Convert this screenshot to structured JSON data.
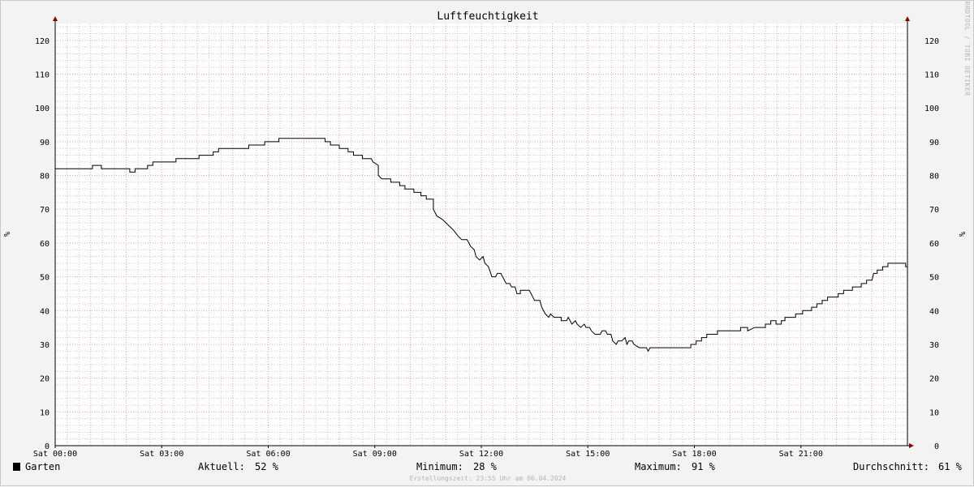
{
  "chart_data": {
    "type": "line",
    "title": "Luftfeuchtigkeit",
    "ylabel": "%",
    "ylim": [
      0,
      125
    ],
    "yticks": [
      0,
      10,
      20,
      30,
      40,
      50,
      60,
      70,
      80,
      90,
      100,
      110,
      120
    ],
    "xlim": [
      0,
      24
    ],
    "xticks": [
      {
        "hour": 0,
        "label": "Sat 00:00"
      },
      {
        "hour": 3,
        "label": "Sat 03:00"
      },
      {
        "hour": 6,
        "label": "Sat 06:00"
      },
      {
        "hour": 9,
        "label": "Sat 09:00"
      },
      {
        "hour": 12,
        "label": "Sat 12:00"
      },
      {
        "hour": 15,
        "label": "Sat 15:00"
      },
      {
        "hour": 18,
        "label": "Sat 18:00"
      },
      {
        "hour": 21,
        "label": "Sat 21:00"
      }
    ],
    "grid": true,
    "series": [
      {
        "name": "Garten",
        "color": "#000000",
        "points": [
          [
            0.0,
            82
          ],
          [
            1.05,
            82
          ],
          [
            1.05,
            83
          ],
          [
            1.3,
            83
          ],
          [
            1.3,
            82
          ],
          [
            2.1,
            82
          ],
          [
            2.1,
            81
          ],
          [
            2.25,
            81
          ],
          [
            2.25,
            82
          ],
          [
            2.6,
            82
          ],
          [
            2.6,
            83
          ],
          [
            2.75,
            83
          ],
          [
            2.75,
            84
          ],
          [
            3.4,
            84
          ],
          [
            3.4,
            85
          ],
          [
            4.05,
            85
          ],
          [
            4.05,
            86
          ],
          [
            4.45,
            86
          ],
          [
            4.45,
            87
          ],
          [
            4.6,
            87
          ],
          [
            4.6,
            88
          ],
          [
            5.45,
            88
          ],
          [
            5.45,
            89
          ],
          [
            5.9,
            89
          ],
          [
            5.9,
            90
          ],
          [
            6.3,
            90
          ],
          [
            6.3,
            91
          ],
          [
            7.6,
            91
          ],
          [
            7.6,
            90
          ],
          [
            7.75,
            90
          ],
          [
            7.75,
            89
          ],
          [
            8.0,
            89
          ],
          [
            8.0,
            88
          ],
          [
            8.25,
            88
          ],
          [
            8.25,
            87
          ],
          [
            8.4,
            87
          ],
          [
            8.4,
            86
          ],
          [
            8.65,
            86
          ],
          [
            8.65,
            85
          ],
          [
            8.9,
            85
          ],
          [
            8.95,
            84
          ],
          [
            9.1,
            83
          ],
          [
            9.1,
            80
          ],
          [
            9.2,
            79
          ],
          [
            9.45,
            79
          ],
          [
            9.45,
            78
          ],
          [
            9.7,
            78
          ],
          [
            9.7,
            77
          ],
          [
            9.85,
            77
          ],
          [
            9.85,
            76
          ],
          [
            10.1,
            76
          ],
          [
            10.1,
            75
          ],
          [
            10.3,
            75
          ],
          [
            10.3,
            74
          ],
          [
            10.45,
            74
          ],
          [
            10.45,
            73
          ],
          [
            10.65,
            73
          ],
          [
            10.65,
            70
          ],
          [
            10.75,
            68
          ],
          [
            10.9,
            67
          ],
          [
            11.0,
            66
          ],
          [
            11.1,
            65
          ],
          [
            11.2,
            64
          ],
          [
            11.35,
            62
          ],
          [
            11.45,
            61
          ],
          [
            11.6,
            61
          ],
          [
            11.7,
            59
          ],
          [
            11.8,
            58
          ],
          [
            11.85,
            56
          ],
          [
            11.95,
            55
          ],
          [
            12.05,
            56
          ],
          [
            12.1,
            54
          ],
          [
            12.2,
            53
          ],
          [
            12.3,
            50
          ],
          [
            12.4,
            50
          ],
          [
            12.45,
            51
          ],
          [
            12.55,
            51
          ],
          [
            12.6,
            50
          ],
          [
            12.7,
            48
          ],
          [
            12.8,
            48
          ],
          [
            12.85,
            47
          ],
          [
            12.95,
            47
          ],
          [
            13.0,
            45
          ],
          [
            13.1,
            45
          ],
          [
            13.1,
            46
          ],
          [
            13.35,
            46
          ],
          [
            13.4,
            45
          ],
          [
            13.5,
            43
          ],
          [
            13.65,
            43
          ],
          [
            13.7,
            41
          ],
          [
            13.8,
            39
          ],
          [
            13.9,
            38
          ],
          [
            13.95,
            39
          ],
          [
            14.05,
            38
          ],
          [
            14.25,
            38
          ],
          [
            14.25,
            37
          ],
          [
            14.4,
            37
          ],
          [
            14.45,
            38
          ],
          [
            14.5,
            37
          ],
          [
            14.55,
            36
          ],
          [
            14.65,
            37
          ],
          [
            14.7,
            36
          ],
          [
            14.8,
            35
          ],
          [
            14.9,
            36
          ],
          [
            14.95,
            35
          ],
          [
            15.05,
            35
          ],
          [
            15.1,
            34
          ],
          [
            15.2,
            33
          ],
          [
            15.35,
            33
          ],
          [
            15.4,
            34
          ],
          [
            15.5,
            34
          ],
          [
            15.55,
            33
          ],
          [
            15.65,
            33
          ],
          [
            15.7,
            31
          ],
          [
            15.8,
            30
          ],
          [
            15.85,
            31
          ],
          [
            15.95,
            31
          ],
          [
            16.05,
            32
          ],
          [
            16.1,
            30
          ],
          [
            16.15,
            31
          ],
          [
            16.25,
            31
          ],
          [
            16.3,
            30
          ],
          [
            16.45,
            29
          ],
          [
            16.65,
            29
          ],
          [
            16.7,
            28
          ],
          [
            16.75,
            29
          ],
          [
            17.0,
            29
          ],
          [
            17.0,
            29
          ],
          [
            17.9,
            29
          ],
          [
            17.9,
            30
          ],
          [
            18.05,
            30
          ],
          [
            18.05,
            31
          ],
          [
            18.2,
            31
          ],
          [
            18.2,
            32
          ],
          [
            18.35,
            32
          ],
          [
            18.35,
            33
          ],
          [
            18.65,
            33
          ],
          [
            18.65,
            34
          ],
          [
            19.3,
            34
          ],
          [
            19.3,
            35
          ],
          [
            19.5,
            35
          ],
          [
            19.5,
            34
          ],
          [
            19.7,
            35
          ],
          [
            20.0,
            35
          ],
          [
            20.0,
            36
          ],
          [
            20.15,
            36
          ],
          [
            20.15,
            37
          ],
          [
            20.3,
            37
          ],
          [
            20.3,
            36
          ],
          [
            20.45,
            36
          ],
          [
            20.45,
            37
          ],
          [
            20.55,
            37
          ],
          [
            20.55,
            38
          ],
          [
            20.85,
            38
          ],
          [
            20.85,
            39
          ],
          [
            21.05,
            39
          ],
          [
            21.05,
            40
          ],
          [
            21.3,
            40
          ],
          [
            21.3,
            41
          ],
          [
            21.45,
            41
          ],
          [
            21.45,
            42
          ],
          [
            21.6,
            42
          ],
          [
            21.6,
            43
          ],
          [
            21.75,
            43
          ],
          [
            21.75,
            44
          ],
          [
            22.05,
            44
          ],
          [
            22.05,
            45
          ],
          [
            22.2,
            45
          ],
          [
            22.2,
            46
          ],
          [
            22.45,
            46
          ],
          [
            22.45,
            47
          ],
          [
            22.7,
            47
          ],
          [
            22.7,
            48
          ],
          [
            22.85,
            48
          ],
          [
            22.85,
            49
          ],
          [
            23.0,
            49
          ],
          [
            23.05,
            51
          ],
          [
            23.15,
            51
          ],
          [
            23.15,
            52
          ],
          [
            23.3,
            52
          ],
          [
            23.3,
            53
          ],
          [
            23.45,
            53
          ],
          [
            23.45,
            54
          ],
          [
            23.95,
            54
          ],
          [
            23.95,
            53
          ],
          [
            24.0,
            53
          ]
        ]
      }
    ]
  },
  "watermark": "RRDTOOL / TOBI OETIKER",
  "legend": {
    "series_name": "Garten",
    "swatch_color": "#000000",
    "current_label": "Aktuell:",
    "current_value": "52 %",
    "min_label": "Minimum:",
    "min_value": "28 %",
    "max_label": "Maximum:",
    "max_value": "91 %",
    "avg_label": "Durchschnitt:",
    "avg_value": "61 %"
  },
  "footer": "Erstellungszeit: 23:55 Uhr am 06.04.2024",
  "colors": {
    "plot_bg": "#ffffff",
    "major_grid": "#f0a0a0",
    "minor_grid": "#c8c8c8",
    "axis": "#000000",
    "arrow": "#8b0000"
  }
}
